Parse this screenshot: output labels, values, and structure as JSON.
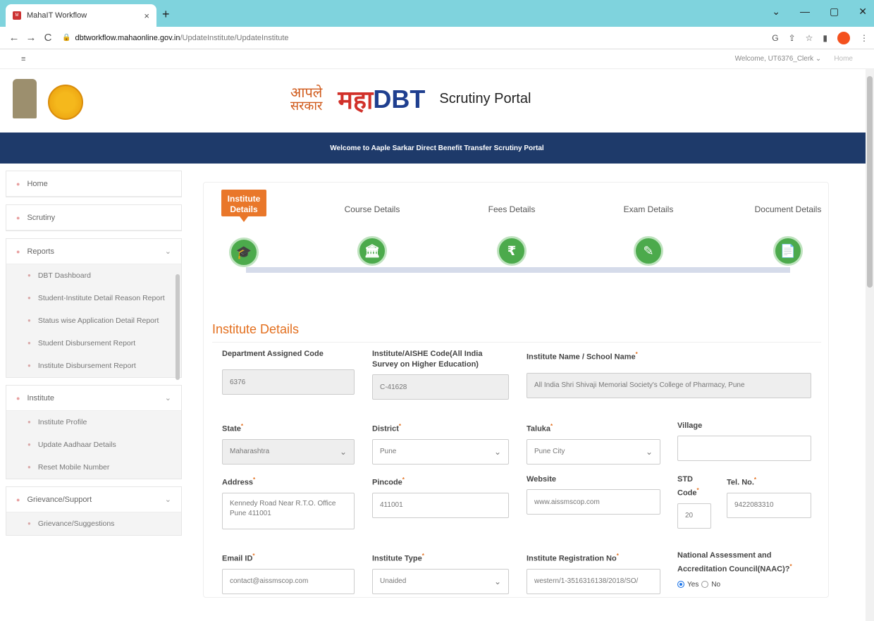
{
  "browser": {
    "tab_title": "MahaIT Workflow",
    "tab_close": "×",
    "new_tab": "+",
    "win_controls": [
      "⌄",
      "—",
      "▢",
      "✕"
    ],
    "url_host": "dbtworkflow.mahaonline.gov.in",
    "url_path": "/UpdateInstitute/UpdateInstitute",
    "nav": [
      "←",
      "→",
      "C"
    ],
    "icons": [
      "G",
      "⇪",
      "☆",
      "▮"
    ]
  },
  "topbar": {
    "menu_icon": "≡",
    "welcome": "Welcome, UT6376_Clerk ⌄",
    "home": "Home"
  },
  "header": {
    "aaple": "आपले",
    "sarkar": "सरकार",
    "maha": "महा",
    "dbt": "DBT",
    "portal": "Scrutiny Portal"
  },
  "banner": "Welcome to Aaple Sarkar Direct Benefit Transfer Scrutiny Portal",
  "sidebar": {
    "home": "Home",
    "scrutiny": "Scrutiny",
    "reports": "Reports",
    "report_items": [
      "DBT Dashboard",
      "Student-Institute Detail Reason Report",
      "Status wise Application Detail Report",
      "Student Disbursement Report",
      "Institute Disbursement Report"
    ],
    "institute": "Institute",
    "institute_items": [
      "Institute Profile",
      "Update Aadhaar Details",
      "Reset Mobile Number"
    ],
    "grievance": "Grievance/Support",
    "grievance_items": [
      "Grievance/Suggestions"
    ]
  },
  "steps": [
    {
      "label": "Institute Details",
      "icon": "🎓"
    },
    {
      "label": "Course Details",
      "icon": "🏛"
    },
    {
      "label": "Fees Details",
      "icon": "₹"
    },
    {
      "label": "Exam Details",
      "icon": "✎"
    },
    {
      "label": "Document Details",
      "icon": "📄"
    }
  ],
  "form": {
    "title": "Institute Details",
    "dept_code_label": "Department Assigned Code",
    "dept_code": "6376",
    "aishe_label": "Institute/AISHE Code(All India Survey on Higher Education)",
    "aishe": "C-41628",
    "inst_name_label": "Institute Name / School Name",
    "inst_name": "All India Shri Shivaji Memorial Society's College of Pharmacy, Pune",
    "state_label": "State",
    "state": "Maharashtra",
    "district_label": "District",
    "district": "Pune",
    "taluka_label": "Taluka",
    "taluka": "Pune City",
    "village_label": "Village",
    "village": "",
    "address_label": "Address",
    "address": "Kennedy Road Near R.T.O. Office Pune 411001",
    "pincode_label": "Pincode",
    "pincode": "411001",
    "website_label": "Website",
    "website": "www.aissmscop.com",
    "std_label": "STD Code",
    "std": "20",
    "tel_label": "Tel. No.",
    "tel": "9422083310",
    "email_label": "Email ID",
    "email": "contact@aissmscop.com",
    "inst_type_label": "Institute Type",
    "inst_type": "Unaided",
    "reg_label": "Institute Registration No",
    "reg": "western/1-3516316138/2018/SO/",
    "naac_label": "National Assessment and Accreditation Council(NAAC)?",
    "naac_yes": "Yes",
    "naac_no": "No",
    "required_mark": "*"
  }
}
